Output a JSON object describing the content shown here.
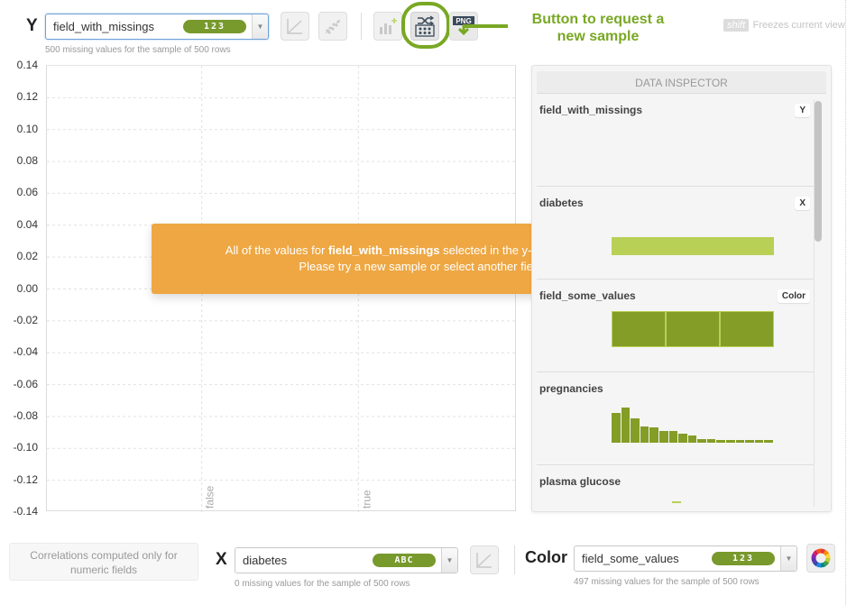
{
  "y_axis": {
    "letter": "Y",
    "field": "field_with_missings",
    "type_badge": "123",
    "missing_note": "500 missing values for the sample of 500 rows"
  },
  "toolbar": {
    "buttons": [
      {
        "name": "regression-line-button",
        "icon": "line-chart-icon"
      },
      {
        "name": "scatter-trend-button",
        "icon": "scatter-icon"
      },
      {
        "name": "add-chart-button",
        "icon": "bar-chart-plus-icon"
      },
      {
        "name": "new-sample-button",
        "icon": "shuffle-sample-icon"
      },
      {
        "name": "export-png-button",
        "icon": "png-download-icon",
        "label": "PNG"
      }
    ],
    "annotation_line1": "Button to request a",
    "annotation_line2": "new sample",
    "shift_key": "shift",
    "shift_hint": "Freezes current view"
  },
  "chart_data": {
    "type": "scatter",
    "title": "",
    "xlabel": "",
    "ylabel": "",
    "ylim": [
      -0.14,
      0.14
    ],
    "yticks": [
      "0.14",
      "0.12",
      "0.10",
      "0.08",
      "0.06",
      "0.04",
      "0.02",
      "0.00",
      "-0.02",
      "-0.04",
      "-0.06",
      "-0.08",
      "-0.10",
      "-0.12",
      "-0.14"
    ],
    "categories": [
      "false",
      "true"
    ],
    "grid": true,
    "series": []
  },
  "alert": {
    "prefix": "All of the values for ",
    "field": "field_with_missings",
    "suffix": " selected in the y-axis are missing.",
    "line2": "Please try a new sample or select another field.",
    "close": "x",
    "color": "#eea743"
  },
  "inspector": {
    "title": "DATA INSPECTOR",
    "items": [
      {
        "name": "field_with_missings",
        "tag": "Y"
      },
      {
        "name": "diabetes",
        "tag": "X"
      },
      {
        "name": "field_some_values",
        "tag": "Color"
      },
      {
        "name": "pregnancies",
        "tag": ""
      },
      {
        "name": "plasma glucose",
        "tag": ""
      }
    ],
    "pregnancies_histogram": [
      0.78,
      0.92,
      0.64,
      0.44,
      0.4,
      0.32,
      0.32,
      0.23,
      0.2,
      0.1,
      0.1,
      0.06,
      0.06,
      0.06,
      0.06,
      0.06,
      0.06
    ]
  },
  "x_axis": {
    "letter": "X",
    "field": "diabetes",
    "type_badge": "ABC",
    "missing_note": "0 missing values for the sample of 500 rows",
    "correlation_note_line1": "Correlations computed only for",
    "correlation_note_line2": "numeric fields"
  },
  "color_axis": {
    "label": "Color",
    "field": "field_some_values",
    "type_badge": "123",
    "missing_note": "497 missing values for the sample of 500 rows"
  },
  "colors": {
    "accent_green": "#79a824",
    "badge_green": "#78992c",
    "bar_green": "#849d27",
    "light_green": "#b8d055",
    "alert_orange": "#eea743"
  }
}
